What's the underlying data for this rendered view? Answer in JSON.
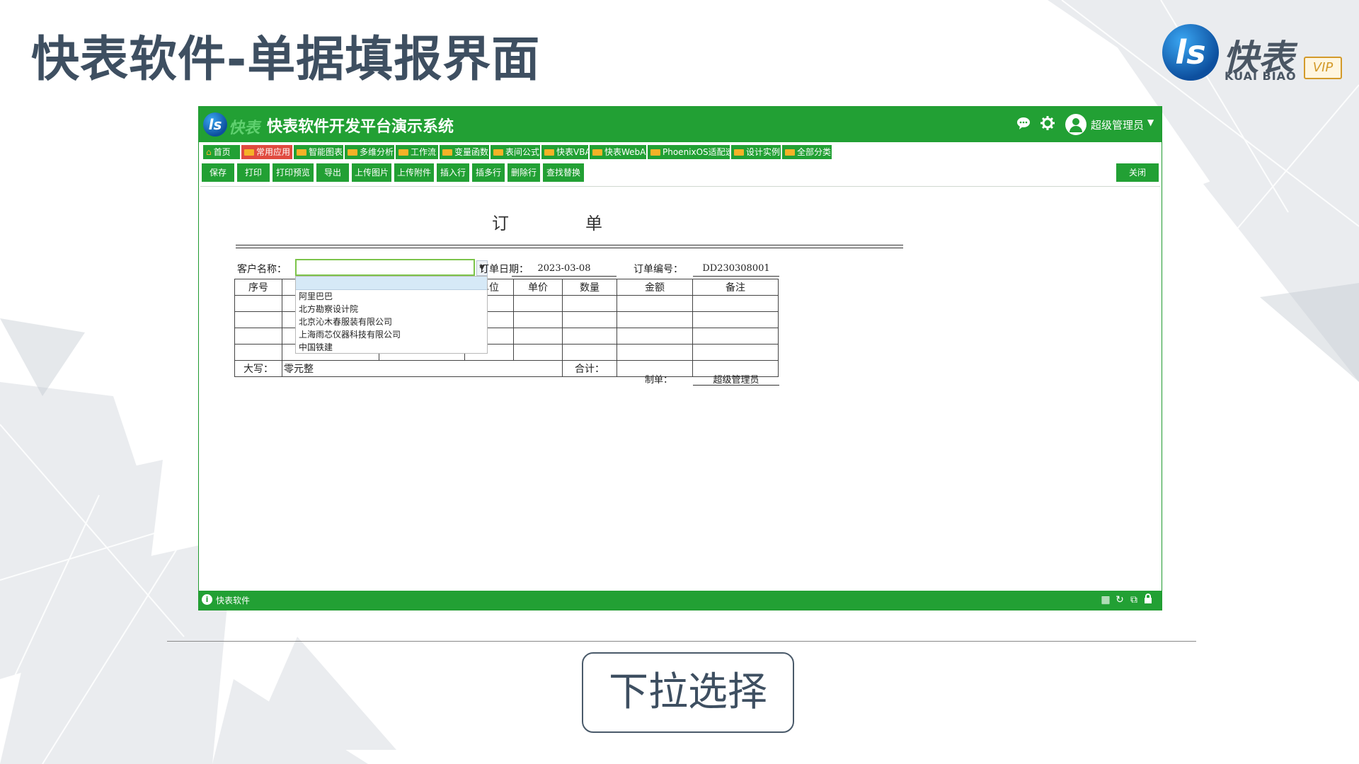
{
  "slide": {
    "title": "快表软件-单据填报界面",
    "caption": "下拉选择"
  },
  "logo": {
    "mark": "ls",
    "cn": "快表",
    "en": "KUAI BIAO",
    "vip": "VIP"
  },
  "app": {
    "logo_mark": "ls",
    "logo_cn": "快表",
    "title": "快表软件开发平台演示系统",
    "header_icons": [
      "chat-icon",
      "gear-icon"
    ],
    "user_name": "超级管理员",
    "tabs": [
      {
        "label": "首页",
        "icon": "home-icon"
      },
      {
        "label": "常用应用",
        "icon": "folder-icon",
        "active": true
      },
      {
        "label": "智能图表",
        "icon": "folder-icon"
      },
      {
        "label": "多维分析",
        "icon": "folder-icon"
      },
      {
        "label": "工作流",
        "icon": "folder-icon"
      },
      {
        "label": "变量函数",
        "icon": "folder-icon"
      },
      {
        "label": "表间公式",
        "icon": "folder-icon"
      },
      {
        "label": "快表VBA",
        "icon": "folder-icon"
      },
      {
        "label": "快表WebApp",
        "icon": "folder-icon"
      },
      {
        "label": "PhoenixOS适配速查",
        "icon": "folder-icon"
      },
      {
        "label": "设计实例",
        "icon": "folder-icon"
      },
      {
        "label": "全部分类",
        "icon": "folder-icon"
      }
    ],
    "toolbar": [
      "保存",
      "打印",
      "打印预览",
      "导出",
      "上传图片",
      "上传附件",
      "插入行",
      "插多行",
      "删除行",
      "查找替换"
    ],
    "close_label": "关闭",
    "status_text": "快表软件",
    "status_icons": [
      "grid-icon",
      "refresh-icon",
      "external-icon",
      "lock-icon"
    ]
  },
  "form": {
    "title_left": "订",
    "title_right": "单",
    "customer_label": "客户名称：",
    "customer_value": "",
    "date_label": "订单日期：",
    "date_value": "2023-03-08",
    "order_no_label": "订单编号：",
    "order_no_value": "DD230308001",
    "columns": [
      "序号",
      "",
      "",
      "单位",
      "单价",
      "数量",
      "金额",
      "备注"
    ],
    "upper_label": "大写：",
    "upper_value": "零元整",
    "total_label": "合计：",
    "total_value": "",
    "maker_label": "制单：",
    "maker_value": "超级管理员"
  },
  "dropdown": {
    "selected": "",
    "options": [
      "阿里巴巴",
      "北方勘察设计院",
      "北京沁木春服装有限公司",
      "上海雨芯仪器科技有限公司",
      "中国铁建"
    ]
  }
}
